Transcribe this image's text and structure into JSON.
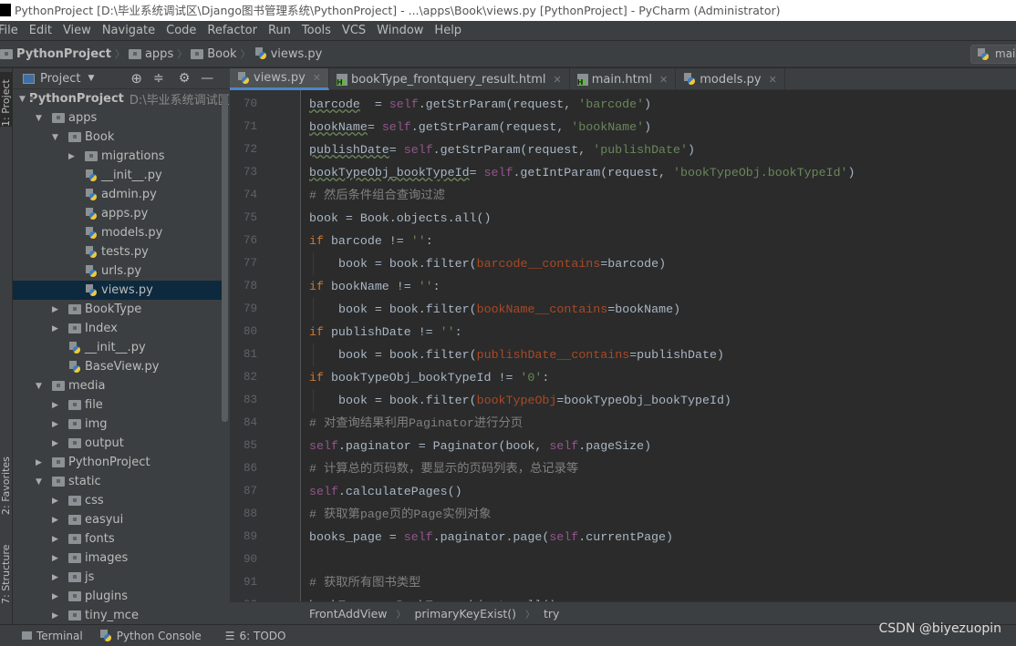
{
  "window": {
    "title": "PythonProject [D:\\毕业系统调试区\\Django图书管理系统\\PythonProject] - ...\\apps\\Book\\views.py [PythonProject] - PyCharm (Administrator)",
    "logo": "PC"
  },
  "menu": [
    "File",
    "Edit",
    "View",
    "Navigate",
    "Code",
    "Refactor",
    "Run",
    "Tools",
    "VCS",
    "Window",
    "Help"
  ],
  "navbar": {
    "crumbs": [
      "PythonProject",
      "apps",
      "Book",
      "views.py"
    ],
    "right_button": "main"
  },
  "left_stripe": {
    "project": "1: Project",
    "favorites": "2: Favorites",
    "structure": "7: Structure"
  },
  "project_panel": {
    "title": "Project",
    "tree": [
      {
        "label": "PythonProject",
        "path": "D:\\毕业系统调试区\\",
        "level": 0,
        "type": "folder",
        "state": "open",
        "bold": true
      },
      {
        "label": "apps",
        "level": 1,
        "type": "folder",
        "state": "open"
      },
      {
        "label": "Book",
        "level": 2,
        "type": "folder",
        "state": "open"
      },
      {
        "label": "migrations",
        "level": 3,
        "type": "folder",
        "state": "closed"
      },
      {
        "label": "__init__.py",
        "level": 3,
        "type": "py"
      },
      {
        "label": "admin.py",
        "level": 3,
        "type": "py"
      },
      {
        "label": "apps.py",
        "level": 3,
        "type": "py"
      },
      {
        "label": "models.py",
        "level": 3,
        "type": "py"
      },
      {
        "label": "tests.py",
        "level": 3,
        "type": "py"
      },
      {
        "label": "urls.py",
        "level": 3,
        "type": "py"
      },
      {
        "label": "views.py",
        "level": 3,
        "type": "py",
        "selected": true
      },
      {
        "label": "BookType",
        "level": 2,
        "type": "folder",
        "state": "closed"
      },
      {
        "label": "Index",
        "level": 2,
        "type": "folder",
        "state": "closed"
      },
      {
        "label": "__init__.py",
        "level": 2,
        "type": "py"
      },
      {
        "label": "BaseView.py",
        "level": 2,
        "type": "py"
      },
      {
        "label": "media",
        "level": 1,
        "type": "folder",
        "state": "open"
      },
      {
        "label": "file",
        "level": 2,
        "type": "folder",
        "state": "closed"
      },
      {
        "label": "img",
        "level": 2,
        "type": "folder",
        "state": "closed"
      },
      {
        "label": "output",
        "level": 2,
        "type": "folder",
        "state": "closed"
      },
      {
        "label": "PythonProject",
        "level": 1,
        "type": "folder",
        "state": "closed"
      },
      {
        "label": "static",
        "level": 1,
        "type": "folder",
        "state": "open"
      },
      {
        "label": "css",
        "level": 2,
        "type": "folder",
        "state": "closed"
      },
      {
        "label": "easyui",
        "level": 2,
        "type": "folder",
        "state": "closed"
      },
      {
        "label": "fonts",
        "level": 2,
        "type": "folder",
        "state": "closed"
      },
      {
        "label": "images",
        "level": 2,
        "type": "folder",
        "state": "closed"
      },
      {
        "label": "js",
        "level": 2,
        "type": "folder",
        "state": "closed"
      },
      {
        "label": "plugins",
        "level": 2,
        "type": "folder",
        "state": "closed"
      },
      {
        "label": "tiny_mce",
        "level": 2,
        "type": "folder",
        "state": "closed"
      }
    ]
  },
  "editor_tabs": [
    {
      "label": "views.py",
      "type": "py",
      "active": true,
      "closable": true
    },
    {
      "label": "bookType_frontquery_result.html",
      "type": "html",
      "closable": true
    },
    {
      "label": "main.html",
      "type": "html",
      "closable": true
    },
    {
      "label": "models.py",
      "type": "py",
      "closable": true
    }
  ],
  "code": [
    {
      "n": "70",
      "indent": 2,
      "t": [
        [
          "wv",
          "barcode"
        ],
        [
          "",
          "  = "
        ],
        [
          "self",
          "self"
        ],
        [
          "",
          ".getStrParam(request, "
        ],
        [
          "str",
          "'barcode'"
        ],
        [
          "",
          ")"
        ]
      ]
    },
    {
      "n": "71",
      "indent": 2,
      "t": [
        [
          "wv",
          "bookName"
        ],
        [
          "",
          "",
          " "
        ],
        [
          "",
          "",
          " "
        ],
        [
          "",
          "= "
        ],
        [
          "self",
          "self"
        ],
        [
          "",
          ".getStrParam(request, "
        ],
        [
          "str",
          "'bookName'"
        ],
        [
          "",
          ")"
        ]
      ]
    },
    {
      "n": "72",
      "indent": 2,
      "t": [
        [
          "wv",
          "publishDate"
        ],
        [
          "",
          "",
          " "
        ],
        [
          "",
          "= "
        ],
        [
          "self",
          "self"
        ],
        [
          "",
          ".getStrParam(request, "
        ],
        [
          "str",
          "'publishDate'"
        ],
        [
          "",
          ")"
        ]
      ]
    },
    {
      "n": "73",
      "indent": 2,
      "t": [
        [
          "wv",
          "bookTypeObj_bookTypeId"
        ],
        [
          "",
          "",
          " "
        ],
        [
          "",
          "= "
        ],
        [
          "self",
          "self"
        ],
        [
          "",
          ".getIntParam(request, "
        ],
        [
          "str",
          "'bookTypeObj.bookTypeId'"
        ],
        [
          "",
          ")"
        ]
      ]
    },
    {
      "n": "74",
      "indent": 2,
      "t": [
        [
          "cm",
          "# 然后条件组合查询过滤"
        ]
      ]
    },
    {
      "n": "75",
      "indent": 2,
      "t": [
        [
          "",
          "book = Book.objects.all()"
        ]
      ]
    },
    {
      "n": "76",
      "indent": 2,
      "t": [
        [
          "kw",
          "if"
        ],
        [
          "",
          " barcode != "
        ],
        [
          "str",
          "''"
        ],
        [
          "",
          ":"
        ]
      ]
    },
    {
      "n": "77",
      "indent": 3,
      "t": [
        [
          "",
          "book = book.filter("
        ],
        [
          "arg",
          "barcode__contains"
        ],
        [
          "",
          "=barcode)"
        ]
      ]
    },
    {
      "n": "78",
      "indent": 2,
      "t": [
        [
          "kw",
          "if"
        ],
        [
          "",
          " bookName != "
        ],
        [
          "str",
          "''"
        ],
        [
          "",
          ":"
        ]
      ]
    },
    {
      "n": "79",
      "indent": 3,
      "t": [
        [
          "",
          "book = book.filter("
        ],
        [
          "arg",
          "bookName__contains"
        ],
        [
          "",
          "=bookName)"
        ]
      ]
    },
    {
      "n": "80",
      "indent": 2,
      "t": [
        [
          "kw",
          "if"
        ],
        [
          "",
          " publishDate != "
        ],
        [
          "str",
          "''"
        ],
        [
          "",
          ":"
        ]
      ]
    },
    {
      "n": "81",
      "indent": 3,
      "t": [
        [
          "",
          "book = book.filter("
        ],
        [
          "arg",
          "publishDate__contains"
        ],
        [
          "",
          "=publishDate)"
        ]
      ]
    },
    {
      "n": "82",
      "indent": 2,
      "t": [
        [
          "kw",
          "if"
        ],
        [
          "",
          " bookTypeObj_bookTypeId != "
        ],
        [
          "str",
          "'0'"
        ],
        [
          "",
          ":"
        ]
      ]
    },
    {
      "n": "83",
      "indent": 3,
      "t": [
        [
          "",
          "book = book.filter("
        ],
        [
          "arg",
          "bookTypeObj"
        ],
        [
          "",
          "=bookTypeObj_bookTypeId)"
        ]
      ]
    },
    {
      "n": "84",
      "indent": 2,
      "t": [
        [
          "cm",
          "# 对查询结果利用Paginator进行分页"
        ]
      ]
    },
    {
      "n": "85",
      "indent": 2,
      "t": [
        [
          "self",
          "self"
        ],
        [
          "",
          ".paginator = Paginator(book, "
        ],
        [
          "self",
          "self"
        ],
        [
          "",
          ".pageSize)"
        ]
      ]
    },
    {
      "n": "86",
      "indent": 2,
      "t": [
        [
          "cm",
          "# 计算总的页码数，要显示的页码列表，总记录等"
        ]
      ]
    },
    {
      "n": "87",
      "indent": 2,
      "t": [
        [
          "self",
          "self"
        ],
        [
          "",
          ".calculatePages()"
        ]
      ]
    },
    {
      "n": "88",
      "indent": 2,
      "t": [
        [
          "cm",
          "# 获取第page页的Page实例对象"
        ]
      ]
    },
    {
      "n": "89",
      "indent": 2,
      "t": [
        [
          "",
          "books_page = "
        ],
        [
          "self",
          "self"
        ],
        [
          "",
          ".paginator.page("
        ],
        [
          "self",
          "self"
        ],
        [
          "",
          ".currentPage)"
        ]
      ]
    },
    {
      "n": "90",
      "indent": 2,
      "t": []
    },
    {
      "n": "91",
      "indent": 2,
      "t": [
        [
          "cm",
          "# 获取所有图书类型"
        ]
      ]
    },
    {
      "n": "92",
      "indent": 2,
      "t": [
        [
          "",
          "bookTypes = BookType.objects.all()"
        ]
      ]
    }
  ],
  "code_colors": {
    "background": "#2b2b2b",
    "keyword": "#cc7832",
    "self": "#94558d",
    "string": "#6a8759",
    "comment": "#808080",
    "named_arg": "#aa4926",
    "text": "#a9b7c6"
  },
  "editor_breadcrumb": [
    "FrontAddView",
    "primaryKeyExist()",
    "try"
  ],
  "statusbar": {
    "terminal": "Terminal",
    "python_console": "Python Console",
    "todo": "6: TODO"
  },
  "watermark": "CSDN @biyezuopin"
}
